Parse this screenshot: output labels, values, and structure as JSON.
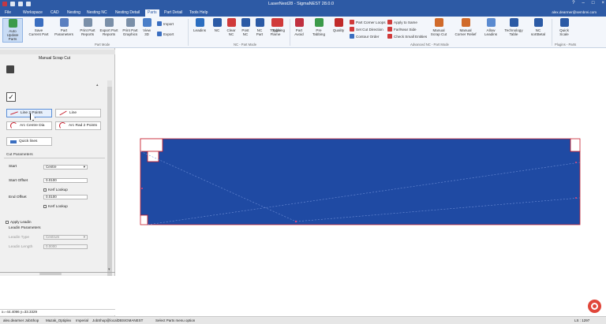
{
  "window": {
    "title": "LaserNest28 - SigmaNEST 28.0.0",
    "user": "alex.dearmer@sembrei.com"
  },
  "menu": [
    "File",
    "Workspace",
    "CAD",
    "Nesting",
    "Nesting NC",
    "Nesting Detail",
    "Parts",
    "Part Detail",
    "Tools Help"
  ],
  "active_tab": "Parts",
  "ribbon": {
    "big": [
      {
        "label": "Auto Update\nParts",
        "color": "#3b9a4a"
      },
      {
        "label": "Save\nCurrent Part",
        "color": "#3a6ec0"
      },
      {
        "label": "Part\nParameters",
        "color": "#5a7fc0"
      },
      {
        "label": "Print Part\nReports",
        "color": "#7a8fa8"
      },
      {
        "label": "Export Part\nReports",
        "color": "#7a8fa8"
      },
      {
        "label": "Print Part\nGraphics",
        "color": "#7a8fa8"
      },
      {
        "label": "View\n3D",
        "color": "#4a7ec8"
      },
      {
        "label": "Leadins",
        "color": "#2b6ec0"
      },
      {
        "label": "NC",
        "color": "#2b5aa5"
      },
      {
        "label": "Clear\nNC",
        "color": "#d03a3a"
      },
      {
        "label": "Post\nNC",
        "color": "#2b5aa5"
      },
      {
        "label": "NC\nPart",
        "color": "#2b5aa5"
      },
      {
        "label": "Toggle\nFlame",
        "color": "#d03a3a"
      },
      {
        "label": "Tabbing",
        "color": "#d03a3a"
      },
      {
        "label": "Part\nAvoid",
        "color": "#c03040"
      },
      {
        "label": "Pre\nTabbing",
        "color": "#3b9a4a"
      },
      {
        "label": "Quality",
        "color": "#c02a2a"
      },
      {
        "label": "Manual\nScrap Cut",
        "color": "#d06a2a"
      },
      {
        "label": "Manual\nCorner Relief",
        "color": "#d06a2a"
      },
      {
        "label": "Allow\nLeadins",
        "color": "#5a8ad0"
      },
      {
        "label": "Technology\nTable",
        "color": "#2b5aa5"
      },
      {
        "label": "NC\nsortBetal",
        "color": "#2b5aa5"
      },
      {
        "label": "Quick\nScale",
        "color": "#2b5aa5"
      }
    ],
    "small": [
      {
        "label": "Import",
        "color": "#3a6ec0"
      },
      {
        "label": "Export",
        "color": "#3a6ec0"
      },
      {
        "label": "Part Corner Loops",
        "color": "#d03a3a"
      },
      {
        "label": "Set Cut Direction",
        "color": "#d03a3a"
      },
      {
        "label": "Contour Order",
        "color": "#3a6ec0"
      },
      {
        "label": "Apply to Same",
        "color": "#d03a3a"
      },
      {
        "label": "Far/Near Side",
        "color": "#d03a3a"
      },
      {
        "label": "Check Small Entities",
        "color": "#d03a3a"
      }
    ],
    "groups": [
      "Part Mode",
      "NC - Part Mode",
      "Advanced NC - Part Mode",
      "Plugins - Parts"
    ]
  },
  "panel": {
    "title": "Manual Scrap Cut",
    "tools": [
      "Line 2 Points",
      "Line",
      "Arc Centre Dia",
      "Arc Rad 2 Points",
      "Quick lines"
    ],
    "section_cut": "Cut Parameters",
    "start_label": "Start",
    "start_value": "Centre",
    "start_offset_label": "Start Offset",
    "start_offset_value": "0.0100",
    "kerf_lookup": "Kerf Lookup",
    "end_offset_label": "End Offset",
    "end_offset_value": "0.0100",
    "apply_leadin": "Apply Leadin",
    "section_leadin": "Leadin Parameters",
    "leadin_type_label": "Leadin Type",
    "leadin_type_value": "Centrum",
    "leadin_length_label": "Leadin Length",
    "leadin_length_value": "0.0000",
    "coords": "x=-44.4096 y=33.3329"
  },
  "status": [
    "alex.dearmer  JobShop",
    "Mazak_Optiplex",
    "Imperial",
    "JobShop@localDBSIGMANEST",
    "Select Parts menu option",
    "LS : 1297"
  ],
  "colors": {
    "title": "#2d5aa5",
    "part_fill": "#1f4aa3",
    "selection": "#c61b2a"
  }
}
